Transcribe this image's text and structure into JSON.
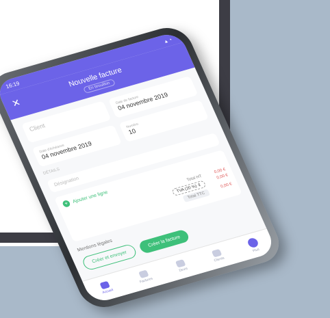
{
  "status": {
    "time": "16:19"
  },
  "header": {
    "title": "Nouvelle facture",
    "subtitle": "En brouillon"
  },
  "form": {
    "client_label": "Client",
    "date_label": "Date de facture",
    "date_value": "04 novembre 2019",
    "due_label": "Date d'échéance",
    "due_value": "04 novembre 2019",
    "details_label": "DÉTAILS",
    "number_label": "Numéro",
    "number_value": "10",
    "designation_placeholder": "Désignation"
  },
  "lines": {
    "add_line_label": "Ajouter une ligne",
    "subtotal_label": "Total HT",
    "subtotal_value": "0,00 €",
    "tva_label": "TVA (20 %)",
    "tva_value": "0,00 €",
    "ttc_label": "Total TTC",
    "ttc_value": "0,00 €"
  },
  "legal": {
    "label": "Mentions légales"
  },
  "actions": {
    "create_label": "Créer la facture",
    "create_send_label": "Créer et envoyer"
  },
  "tabs": [
    {
      "label": "Accueil"
    },
    {
      "label": "Factures"
    },
    {
      "label": "Devis"
    },
    {
      "label": "Clients"
    },
    {
      "label": "Plus"
    }
  ],
  "colors": {
    "primary": "#6c63e8",
    "accent": "#3ec07a",
    "amount": "#e05a5a"
  }
}
